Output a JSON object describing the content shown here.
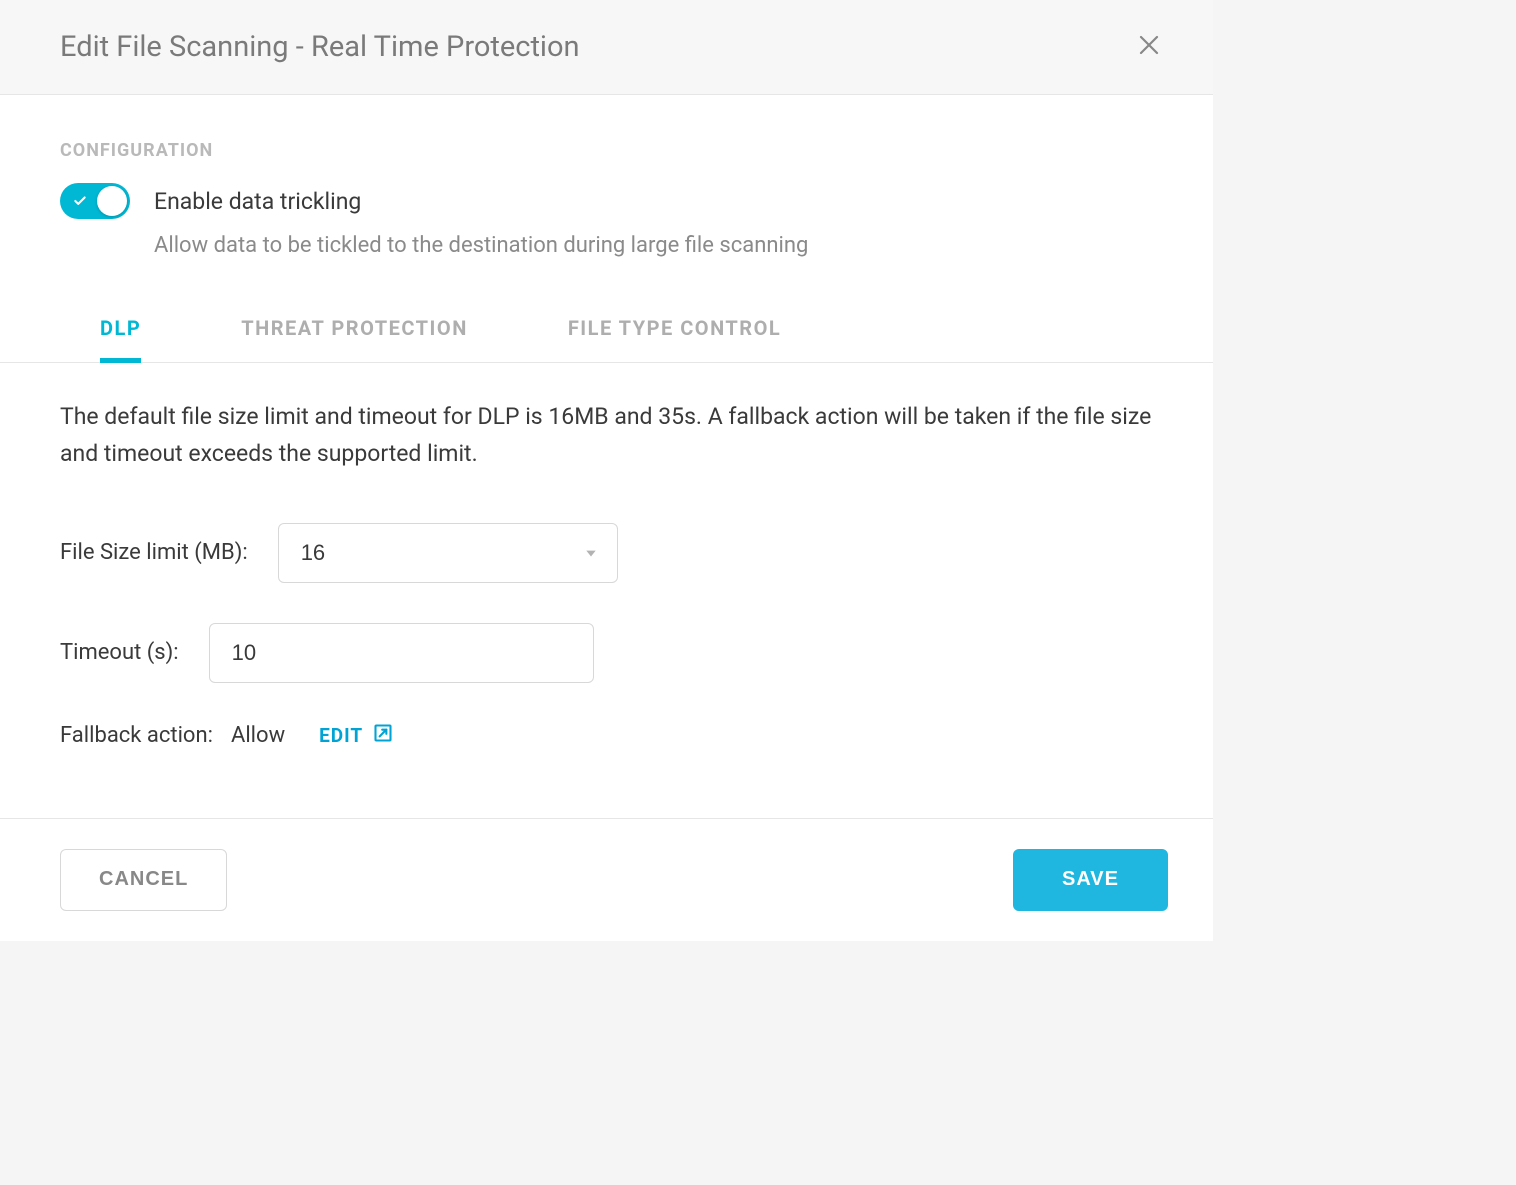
{
  "header": {
    "title": "Edit File Scanning - Real Time Protection"
  },
  "config": {
    "section_label": "CONFIGURATION",
    "toggle_label": "Enable data trickling",
    "toggle_desc": "Allow data to be tickled to the destination during large file scanning"
  },
  "tabs": [
    {
      "label": "DLP",
      "active": true
    },
    {
      "label": "THREAT PROTECTION",
      "active": false
    },
    {
      "label": "FILE TYPE CONTROL",
      "active": false
    }
  ],
  "dlp": {
    "description": "The default file size limit and timeout for DLP is 16MB and 35s. A fallback action will be taken if the file size and timeout exceeds the supported limit.",
    "file_size_label": "File Size limit (MB):",
    "file_size_value": "16",
    "timeout_label": "Timeout (s):",
    "timeout_value": "10",
    "fallback_label": "Fallback action:",
    "fallback_value": "Allow",
    "edit_label": "EDIT"
  },
  "footer": {
    "cancel": "CANCEL",
    "save": "SAVE"
  }
}
